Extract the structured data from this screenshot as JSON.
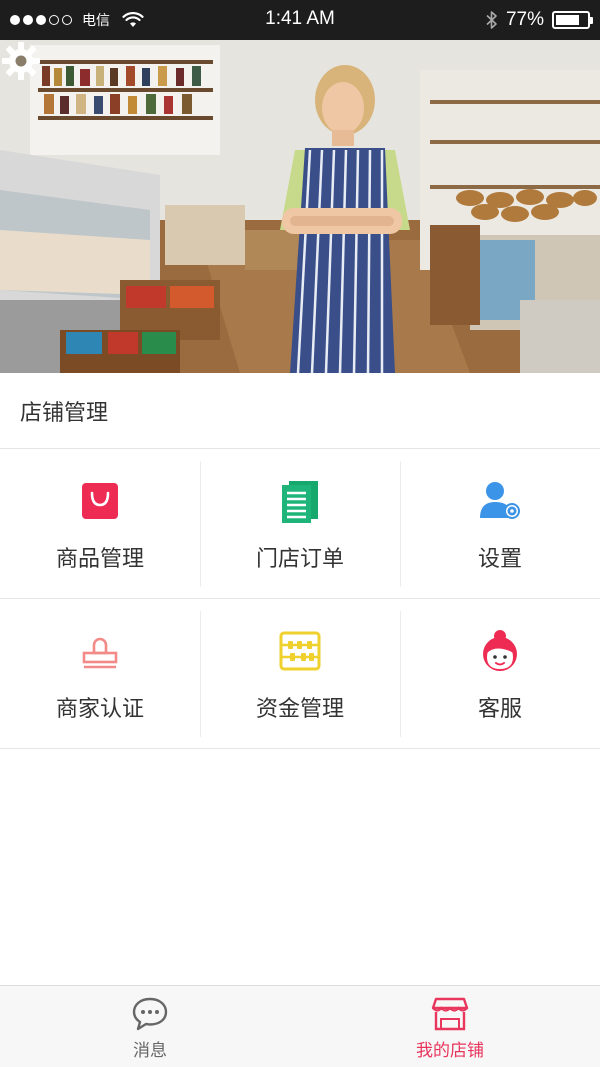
{
  "status_bar": {
    "carrier": "电信",
    "time": "1:41 AM",
    "battery_percent": "77%",
    "battery_level": 0.77
  },
  "hero": {
    "settings_icon": "gear-icon"
  },
  "section": {
    "title": "店铺管理"
  },
  "grid": {
    "items": [
      {
        "label": "商品管理",
        "icon": "shopping-bag-icon",
        "color": "#ee2b53"
      },
      {
        "label": "门店订单",
        "icon": "document-list-icon",
        "color": "#1fb57a"
      },
      {
        "label": "设置",
        "icon": "user-settings-icon",
        "color": "#3b94e8"
      },
      {
        "label": "商家认证",
        "icon": "stamp-icon",
        "color": "#f28b88"
      },
      {
        "label": "资金管理",
        "icon": "abacus-icon",
        "color": "#f0d02c"
      },
      {
        "label": "客服",
        "icon": "customer-service-icon",
        "color": "#ee2b53"
      }
    ]
  },
  "tab_bar": {
    "tabs": [
      {
        "label": "消息",
        "icon": "chat-bubble-icon",
        "active": false
      },
      {
        "label": "我的店铺",
        "icon": "storefront-icon",
        "active": true
      }
    ],
    "active_color": "#e8365d",
    "inactive_color": "#666666"
  }
}
